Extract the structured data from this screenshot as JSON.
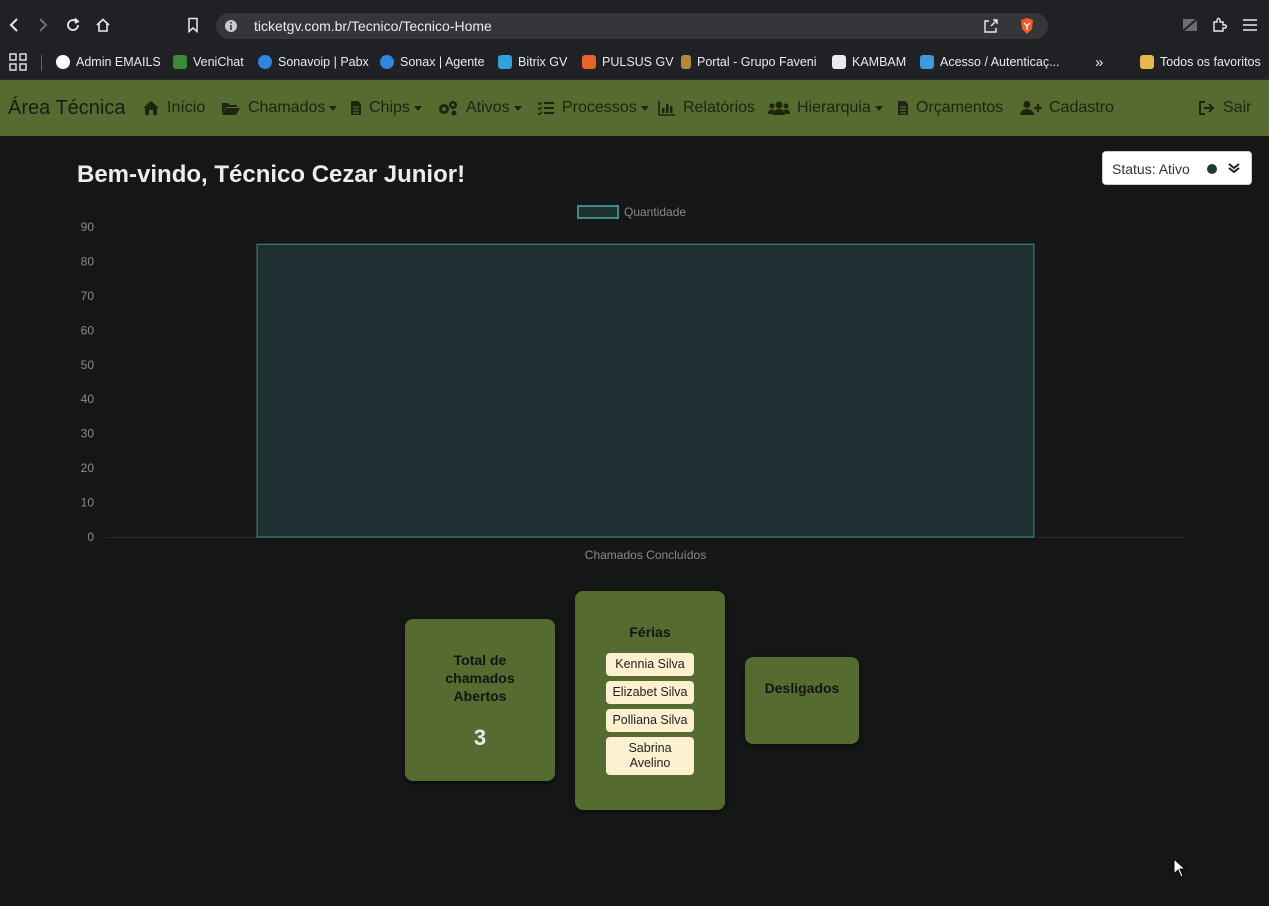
{
  "browser": {
    "url": "ticketgv.com.br/Tecnico/Tecnico-Home",
    "bookmarks": [
      {
        "label": "Admin EMAILS",
        "color": "#4285f4"
      },
      {
        "label": "VeniChat",
        "color": "#3a8a3a"
      },
      {
        "label": "Sonavoip | Pabx",
        "color": "#2e86de"
      },
      {
        "label": "Sonax | Agente",
        "color": "#2e86de"
      },
      {
        "label": "Bitrix GV",
        "color": "#2fa0e0"
      },
      {
        "label": "PULSUS GV",
        "color": "#e8632a"
      },
      {
        "label": "Portal - Grupo Faveni",
        "color": "#b08a3c"
      },
      {
        "label": "KAMBAM",
        "color": "#e8eaed"
      },
      {
        "label": "Acesso / Autenticaç...",
        "color": "#3b9ad9"
      }
    ],
    "more_bookmarks": "»",
    "all_favorites": "Todos os favoritos"
  },
  "navbar": {
    "brand": "Área Técnica",
    "items": [
      {
        "label": "Início",
        "icon": "home-icon",
        "dropdown": false
      },
      {
        "label": "Chamados",
        "icon": "folder-open-icon",
        "dropdown": true
      },
      {
        "label": "Chips",
        "icon": "file-icon",
        "dropdown": true
      },
      {
        "label": "Ativos",
        "icon": "cogs-icon",
        "dropdown": true
      },
      {
        "label": "Processos",
        "icon": "tasks-icon",
        "dropdown": true
      },
      {
        "label": "Relatórios",
        "icon": "bar-chart-icon",
        "dropdown": false
      },
      {
        "label": "Hierarquia",
        "icon": "users-icon",
        "dropdown": true
      },
      {
        "label": "Orçamentos",
        "icon": "file-text-icon",
        "dropdown": false
      },
      {
        "label": "Cadastro",
        "icon": "user-plus-icon",
        "dropdown": false
      }
    ],
    "logout": "Sair"
  },
  "main": {
    "welcome": "Bem-vindo, Técnico Cezar Junior!",
    "status": {
      "label": "Status: Ativo",
      "dot_color": "#1e3d2c"
    }
  },
  "chart_data": {
    "type": "bar",
    "categories": [
      "Chamados Concluídos"
    ],
    "series": [
      {
        "name": "Quantidade",
        "values": [
          85
        ]
      }
    ],
    "yticks": [
      0,
      10,
      20,
      30,
      40,
      50,
      60,
      70,
      80,
      90
    ],
    "ylim": [
      0,
      90
    ],
    "legend": "top-center",
    "grid": false,
    "bar_fill": "#1d2f31",
    "bar_stroke": "#3f8a87"
  },
  "cards": {
    "total": {
      "title": "Total de chamados Abertos",
      "value": "3"
    },
    "ferias": {
      "title": "Férias",
      "names": [
        "Kennia Silva",
        "Elizabet Silva",
        "Polliana Silva",
        "Sabrina Avelino"
      ]
    },
    "desligados": {
      "title": "Desligados"
    }
  }
}
